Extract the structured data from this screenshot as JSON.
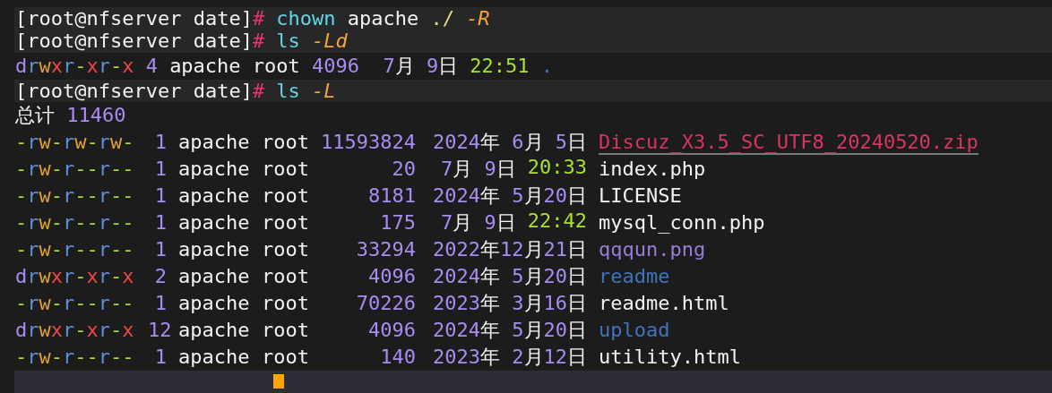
{
  "lines": [
    {
      "kind": "prompt",
      "prompt": "[root@nfserver date]",
      "symbol": "#",
      "segments": [
        {
          "text": "chown",
          "kind": "command"
        },
        {
          "text": "apache",
          "kind": "plain"
        },
        {
          "text": "./",
          "kind": "path"
        },
        {
          "text": "-R",
          "kind": "flag"
        }
      ]
    },
    {
      "kind": "prompt",
      "prompt": "[root@nfserver date]",
      "symbol": "#",
      "segments": [
        {
          "text": "ls",
          "kind": "command"
        },
        {
          "text": "-Ld",
          "kind": "flag"
        }
      ]
    },
    {
      "kind": "output",
      "segments": [
        {
          "text": "drwxr-xr-x",
          "kind": "permissions"
        },
        {
          "text": "4",
          "kind": "number"
        },
        {
          "text": "apache",
          "kind": "plain"
        },
        {
          "text": "root",
          "kind": "plain"
        },
        {
          "text": "4096",
          "kind": "number"
        },
        {
          "text": " 7月 9日",
          "kind": "date"
        },
        {
          "text": "22:51",
          "kind": "time"
        },
        {
          "text": ".",
          "kind": "directory"
        }
      ]
    },
    {
      "kind": "prompt",
      "prompt": "[root@nfserver date]",
      "symbol": "#",
      "segments": [
        {
          "text": "ls",
          "kind": "command"
        },
        {
          "text": "-L",
          "kind": "flag"
        }
      ]
    },
    {
      "kind": "output",
      "segments": [
        {
          "text": "总计",
          "kind": "plain"
        },
        {
          "text": "11460",
          "kind": "number"
        }
      ]
    }
  ],
  "listing": [
    {
      "permissions": "-rw-rw-rw-",
      "links": "1",
      "owner": "apache",
      "group": "root",
      "size": "11593824",
      "date": "2024年 6月 5日",
      "name": "Discuz_X3.5_SC_UTF8_20240520.zip",
      "kind": "archive"
    },
    {
      "permissions": "-rw-r--r--",
      "links": "1",
      "owner": "apache",
      "group": "root",
      "size": "20",
      "date": "7月 9日",
      "time": "20:33",
      "name": "index.php",
      "kind": "file"
    },
    {
      "permissions": "-rw-r--r--",
      "links": "1",
      "owner": "apache",
      "group": "root",
      "size": "8181",
      "date": "2024年 5月20日",
      "name": "LICENSE",
      "kind": "file"
    },
    {
      "permissions": "-rw-r--r--",
      "links": "1",
      "owner": "apache",
      "group": "root",
      "size": "175",
      "date": "7月 9日",
      "time": "22:42",
      "name": "mysql_conn.php",
      "kind": "file"
    },
    {
      "permissions": "-rw-r--r--",
      "links": "1",
      "owner": "apache",
      "group": "root",
      "size": "33294",
      "date": "2022年12月21日",
      "name": "qqqun.png",
      "kind": "image"
    },
    {
      "permissions": "drwxr-xr-x",
      "links": "2",
      "owner": "apache",
      "group": "root",
      "size": "4096",
      "date": "2024年 5月20日",
      "name": "readme",
      "kind": "directory"
    },
    {
      "permissions": "-rw-r--r--",
      "links": "1",
      "owner": "apache",
      "group": "root",
      "size": "70226",
      "date": "2023年 3月16日",
      "name": "readme.html",
      "kind": "file"
    },
    {
      "permissions": "drwxr-xr-x",
      "links": "12",
      "owner": "apache",
      "group": "root",
      "size": "4096",
      "date": "2024年 5月20日",
      "name": "upload",
      "kind": "directory"
    },
    {
      "permissions": "-rw-r--r--",
      "links": "1",
      "owner": "apache",
      "group": "root",
      "size": "140",
      "date": "2023年 2月12日",
      "name": "utility.html",
      "kind": "file"
    }
  ]
}
